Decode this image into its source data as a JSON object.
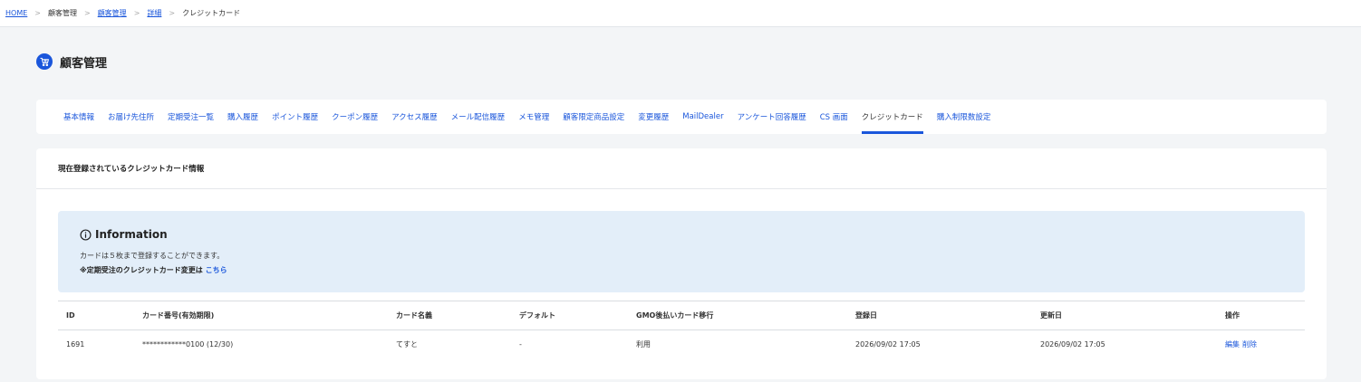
{
  "breadcrumb": {
    "items": [
      {
        "label": "HOME",
        "link": true
      },
      {
        "label": "顧客管理",
        "link": false
      },
      {
        "label": "顧客管理",
        "link": true
      },
      {
        "label": "詳細",
        "link": true
      },
      {
        "label": "クレジットカード",
        "link": false
      }
    ],
    "separator": ">"
  },
  "page": {
    "title": "顧客管理",
    "icon": "cart-icon"
  },
  "tabs": [
    {
      "label": "基本情報"
    },
    {
      "label": "お届け先住所"
    },
    {
      "label": "定期受注一覧"
    },
    {
      "label": "購入履歴"
    },
    {
      "label": "ポイント履歴"
    },
    {
      "label": "クーポン履歴"
    },
    {
      "label": "アクセス履歴"
    },
    {
      "label": "メール配信履歴"
    },
    {
      "label": "メモ管理"
    },
    {
      "label": "顧客限定商品設定"
    },
    {
      "label": "変更履歴"
    },
    {
      "label": "MailDealer"
    },
    {
      "label": "アンケート回答履歴"
    },
    {
      "label": "CS 画面"
    },
    {
      "label": "クレジットカード",
      "active": true
    },
    {
      "label": "購入制限数設定"
    }
  ],
  "section": {
    "title": "現在登録されているクレジットカード情報"
  },
  "info": {
    "icon": "info-icon",
    "title": "Information",
    "text1": "カードは５枚まで登録することができます。",
    "text2": "※定期受注のクレジットカード変更は",
    "link": "こちら"
  },
  "table": {
    "headers": [
      "ID",
      "カード番号(有効期限)",
      "カード名義",
      "デフォルト",
      "GMO後払いカード移行",
      "登録日",
      "更新日",
      "操作"
    ],
    "rows": [
      {
        "id": "1691",
        "card_number": "************0100 (12/30)",
        "holder": "てすと",
        "default": "-",
        "gmo": "利用",
        "registered": "2026/09/02 17:05",
        "updated": "2026/09/02 17:05",
        "edit": "編集",
        "delete": "削除"
      }
    ]
  },
  "colors": {
    "accent": "#1a56db",
    "info_bg": "#e3eef9",
    "page_bg": "#f3f5f7"
  }
}
